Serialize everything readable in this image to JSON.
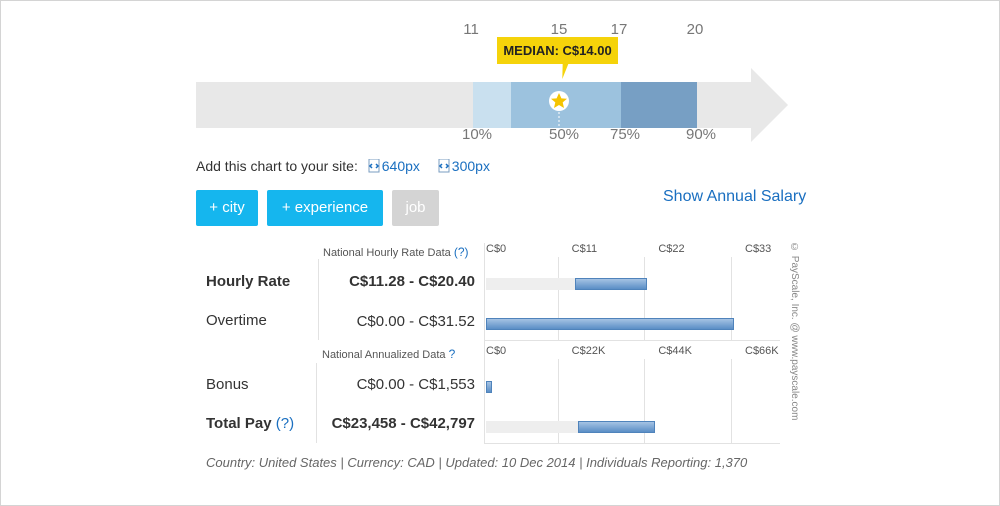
{
  "chart_data": [
    {
      "type": "bar",
      "kind": "percentile_range",
      "median_label": "MEDIAN: C$14.00",
      "median_value": 14.0,
      "scale_labels": [
        "11",
        "15",
        "17",
        "20"
      ],
      "scale_values": [
        11,
        15,
        17,
        20
      ],
      "percentile_labels": [
        "10%",
        "50%",
        "75%",
        "90%"
      ],
      "colors": [
        "#c9e0ef",
        "#9cc2de",
        "#779fc4",
        "#e8e8e8"
      ]
    },
    {
      "type": "bar",
      "kind": "range_table",
      "sections": [
        {
          "header": "National Hourly Rate Data",
          "ticks": [
            "C$0",
            "C$11",
            "C$22",
            "C$33"
          ],
          "xlim": [
            0,
            33
          ],
          "rows": [
            {
              "label": "Hourly Rate",
              "range_text": "C$11.28 - C$20.40",
              "low": 11.28,
              "high": 20.4,
              "bold": true
            },
            {
              "label": "Overtime",
              "range_text": "C$0.00 - C$31.52",
              "low": 0.0,
              "high": 31.52,
              "bold": false
            }
          ]
        },
        {
          "header": "National Annualized Data",
          "ticks": [
            "C$0",
            "C$22K",
            "C$44K",
            "C$66K"
          ],
          "xlim": [
            0,
            66000
          ],
          "rows": [
            {
              "label": "Bonus",
              "range_text": "C$0.00 - C$1,553",
              "low": 0.0,
              "high": 1553,
              "bold": false
            },
            {
              "label": "Total Pay",
              "range_text": "C$23,458 - C$42,797",
              "low": 23458,
              "high": 42797,
              "bold": true
            }
          ]
        }
      ]
    }
  ],
  "ui": {
    "embed_text": "Add this chart to your site:",
    "embed_640": "640px",
    "embed_300": "300px",
    "btn_city": "+ city",
    "btn_experience": "+ experience",
    "btn_job": "job",
    "show_annual": "Show Annual Salary",
    "help_mark": "(?)",
    "help_q": "?",
    "total_pay_label": "Total Pay",
    "credit": "© PayScale, Inc. @ www.payscale.com",
    "footer": "Country: United States | Currency: CAD | Updated: 10 Dec 2014 | Individuals Reporting: 1,370"
  }
}
